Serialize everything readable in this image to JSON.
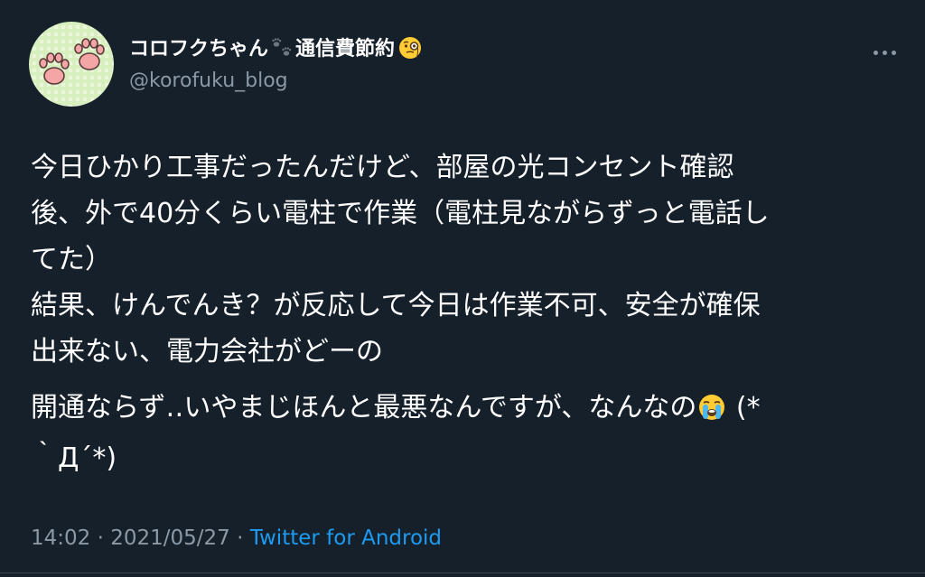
{
  "author": {
    "display_name": "コロフクちゃん",
    "display_name_suffix": "通信費節約",
    "handle": "@korofuku_blog",
    "avatar_icon": "paw-avatar-icon",
    "name_icons": [
      "paw-prints-icon",
      "monocle-face-emoji-icon"
    ]
  },
  "tweet": {
    "lines": [
      "今日ひかり工事だったんだけど、部屋の光コンセント確認",
      "後、外で40分くらい電柱で作業（電柱見ながらずっと電話し",
      "てた）",
      "結果、けんでんき？が反応して今日は作業不可、安全が確保",
      "出来ない、電力会社がどーの"
    ],
    "line6_before_emoji": "開通ならず‥いやまじほんと最悪なんですが、なんなの",
    "line6_after_emoji": " (*",
    "line7": "｀Д´*)",
    "emoji_icon": "loudly-crying-face-emoji-icon"
  },
  "meta": {
    "time": "14:02",
    "separator1": " · ",
    "date": "2021/05/27",
    "separator2": " · ",
    "source": "Twitter for Android"
  },
  "colors": {
    "background": "#15202b",
    "primary_text": "#ffffff",
    "secondary_text": "#8b98a5",
    "accent": "#1d9bf0"
  }
}
